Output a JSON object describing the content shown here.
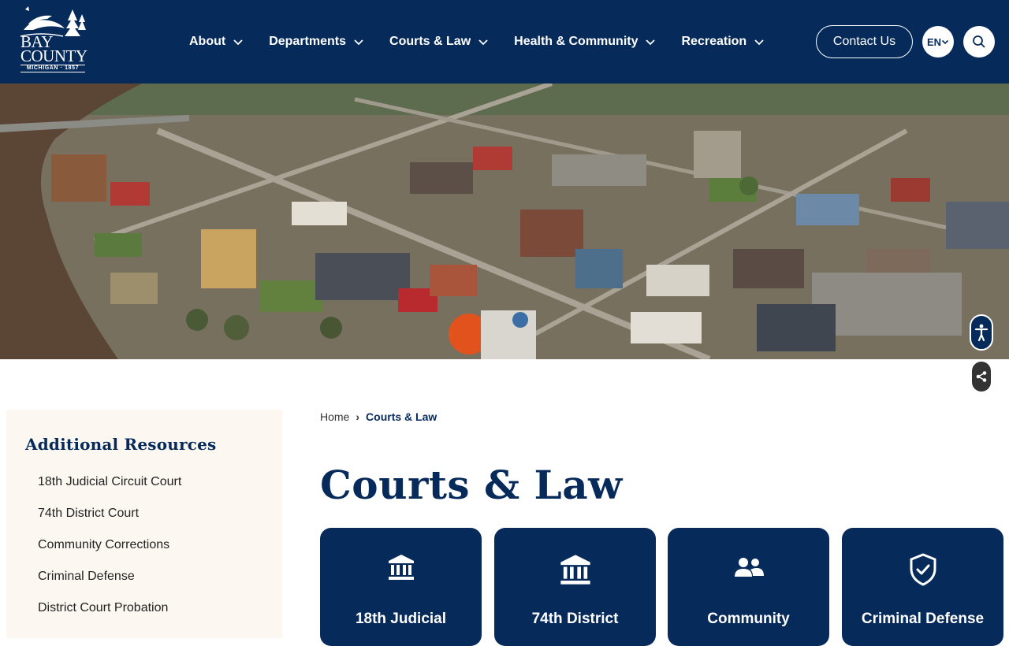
{
  "header": {
    "logo": {
      "line1": "BAY",
      "line2": "COUNTY",
      "sub": "MICHIGAN · 1857"
    },
    "nav": [
      {
        "label": "About"
      },
      {
        "label": "Departments"
      },
      {
        "label": "Courts & Law"
      },
      {
        "label": "Health & Community"
      },
      {
        "label": "Recreation"
      }
    ],
    "contact_label": "Contact Us",
    "language": "EN",
    "icons": {
      "search": "search-icon",
      "chevron": "chevron-down-icon"
    }
  },
  "floating": {
    "accessibility_icon": "accessibility-icon",
    "share_icon": "share-icon"
  },
  "sidebar": {
    "title": "Additional Resources",
    "items": [
      {
        "label": "18th Judicial Circuit Court"
      },
      {
        "label": "74th District Court"
      },
      {
        "label": "Community Corrections"
      },
      {
        "label": "Criminal Defense"
      },
      {
        "label": "District Court Probation"
      }
    ]
  },
  "breadcrumb": {
    "home": "Home",
    "separator": "›",
    "current": "Courts & Law"
  },
  "main": {
    "title": "Courts & Law",
    "cards": [
      {
        "label": "18th Judicial",
        "icon": "courthouse-icon"
      },
      {
        "label": "74th District",
        "icon": "courthouse-icon"
      },
      {
        "label": "Community",
        "icon": "people-icon"
      },
      {
        "label": "Criminal Defense",
        "icon": "shield-check-icon"
      }
    ]
  },
  "colors": {
    "navy": "#062a5a",
    "sidebar_bg": "#fcf8f1",
    "white": "#ffffff"
  }
}
